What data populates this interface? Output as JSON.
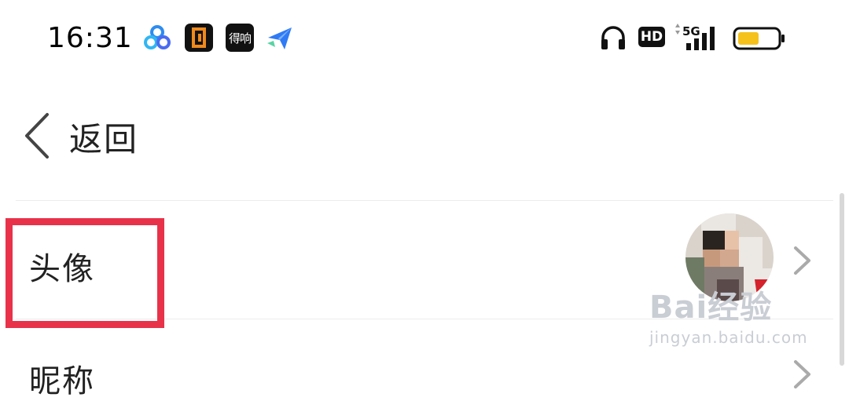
{
  "status_bar": {
    "time": "16:31",
    "app_icons": [
      "baidu-netdisk-icon",
      "orange-app-icon",
      "dedao-icon",
      "feishu-plane-icon"
    ],
    "dedao_text": "得响",
    "hd_label": "HD",
    "network_label": "5G",
    "battery_color": "#f5c21b"
  },
  "nav": {
    "back_label": "返回"
  },
  "settings": {
    "rows": [
      {
        "label": "头像"
      },
      {
        "label": "昵称"
      }
    ]
  },
  "highlight_color": "#e8324a",
  "watermark": {
    "main": "Bai经验",
    "sub": "jingyan.baidu.com"
  }
}
